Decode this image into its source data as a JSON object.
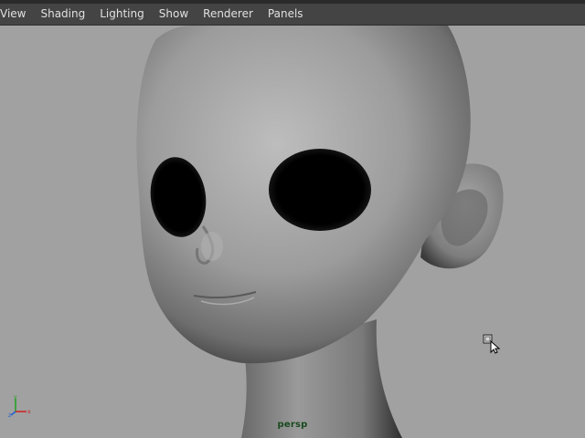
{
  "menu": {
    "items": [
      {
        "label": "View"
      },
      {
        "label": "Shading"
      },
      {
        "label": "Lighting"
      },
      {
        "label": "Show"
      },
      {
        "label": "Renderer"
      },
      {
        "label": "Panels"
      }
    ]
  },
  "viewport": {
    "camera_label": "persp",
    "background_color": "#a1a1a1",
    "model": "smooth-shaded character head"
  },
  "axis_gizmo": {
    "x_label": "x",
    "y_label": "y",
    "z_label": "z",
    "x_color": "#d02020",
    "y_color": "#20a020",
    "z_color": "#2060d0"
  }
}
